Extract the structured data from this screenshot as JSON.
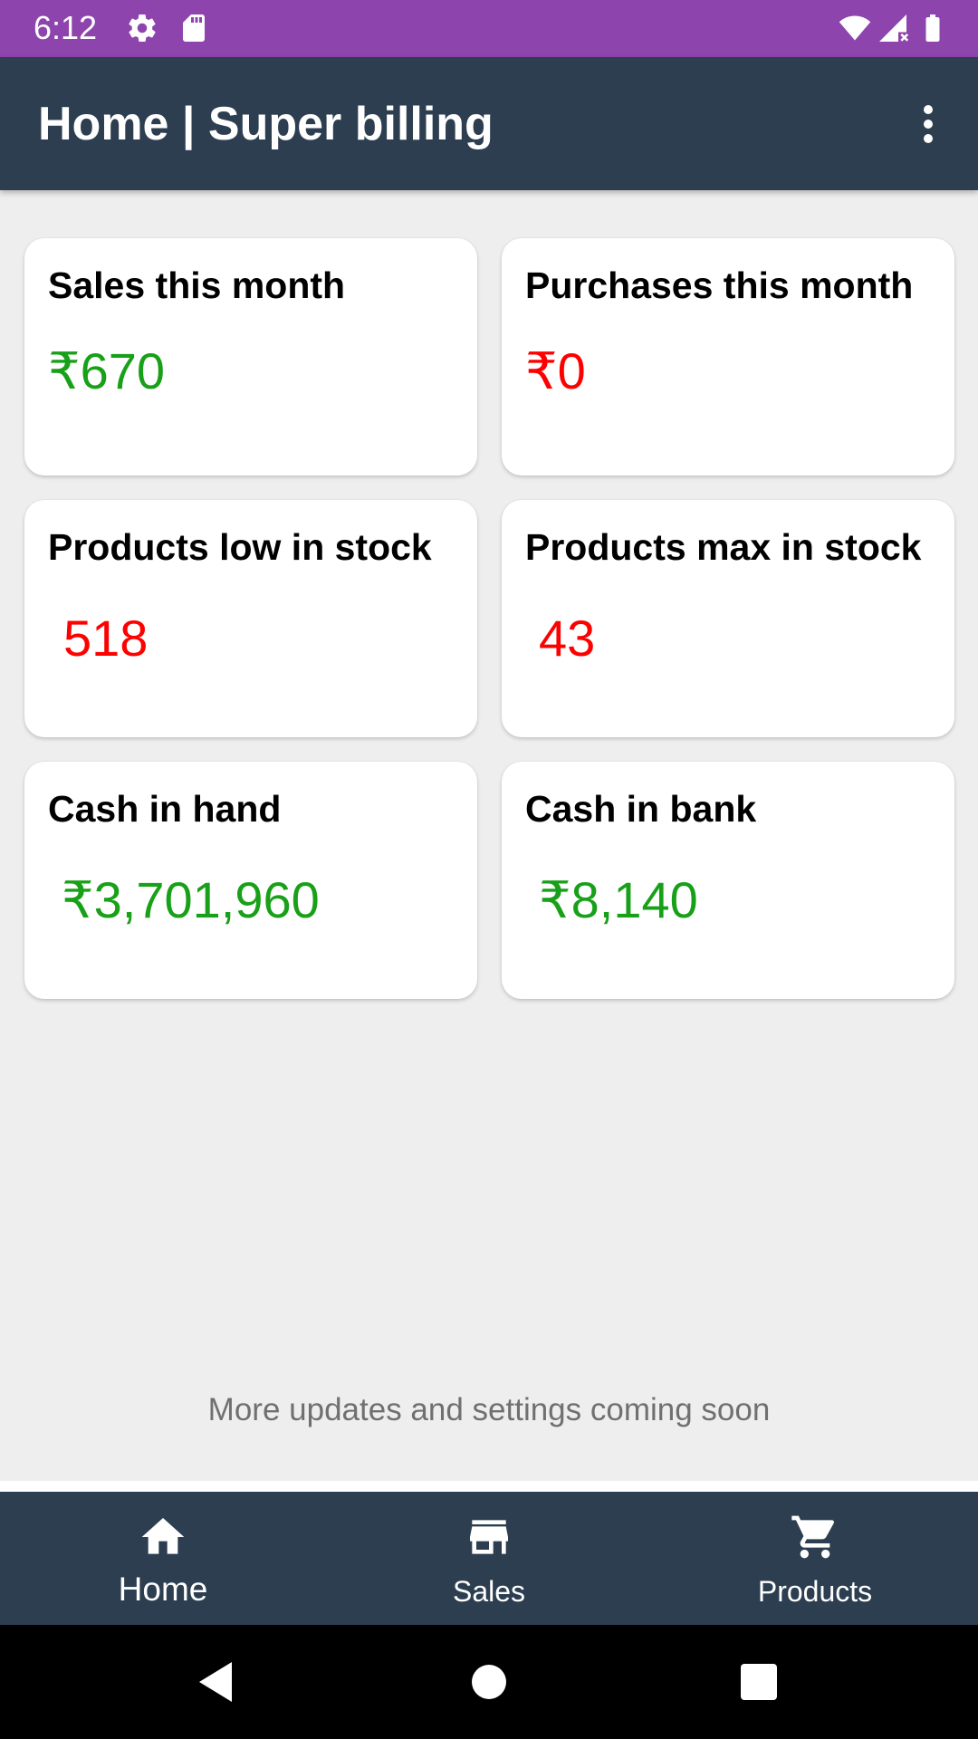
{
  "status_bar": {
    "time": "6:12",
    "background_color": "#8e44ad",
    "icons": [
      "gear-icon",
      "sd-card-icon",
      "wifi-icon",
      "signal-icon",
      "battery-icon"
    ]
  },
  "app_bar": {
    "title": "Home | Super billing",
    "background_color": "#2c3e50",
    "menu_icon": "more-vert-icon"
  },
  "cards": [
    {
      "title": "Sales this month",
      "value": "₹670",
      "value_color": "#18a018"
    },
    {
      "title": "Purchases this month",
      "value": "₹0",
      "value_color": "#ff0000"
    },
    {
      "title": "Products low in stock",
      "value": "518",
      "value_color": "#ff0000"
    },
    {
      "title": "Products max in stock",
      "value": "43",
      "value_color": "#ff0000"
    },
    {
      "title": "Cash in hand",
      "value": "₹3,701,960",
      "value_color": "#18a018"
    },
    {
      "title": "Cash in bank",
      "value": "₹8,140",
      "value_color": "#18a018"
    }
  ],
  "footer_note": "More updates and settings coming soon",
  "bottom_nav": {
    "background_color": "#2c3e50",
    "items": [
      {
        "label": "Home",
        "icon": "home-icon",
        "selected": true
      },
      {
        "label": "Sales",
        "icon": "store-icon",
        "selected": false
      },
      {
        "label": "Products",
        "icon": "cart-icon",
        "selected": false
      }
    ]
  },
  "system_nav": {
    "buttons": [
      "back-icon",
      "home-circle-icon",
      "recents-square-icon"
    ]
  }
}
